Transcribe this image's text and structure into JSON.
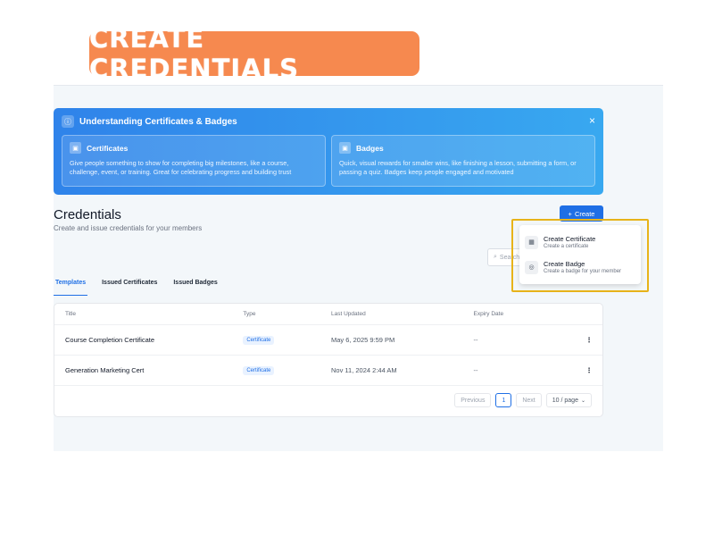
{
  "banner": {
    "text": "CREATE CREDENTIALS"
  },
  "info": {
    "title": "Understanding Certificates & Badges",
    "close": "×",
    "certificates": {
      "title": "Certificates",
      "desc": "Give people something to show for completing big milestones, like a course, challenge, event, or training. Great for celebrating progress and building trust"
    },
    "badges": {
      "title": "Badges",
      "desc": "Quick, visual rewards for smaller wins, like finishing a lesson, submitting a form, or passing a quiz. Badges keep people engaged and motivated"
    }
  },
  "page": {
    "title": "Credentials",
    "subtitle": "Create and issue credentials for your members",
    "create_label": "Create",
    "search_placeholder": "Search"
  },
  "dropdown": {
    "items": [
      {
        "title": "Create Certificate",
        "sub": "Create a certificate"
      },
      {
        "title": "Create Badge",
        "sub": "Create a badge for your member"
      }
    ]
  },
  "tabs": [
    "Templates",
    "Issued Certificates",
    "Issued Badges"
  ],
  "table": {
    "headers": [
      "Title",
      "Type",
      "Last Updated",
      "Expiry Date"
    ],
    "rows": [
      {
        "title": "Course Completion Certificate",
        "type": "Certificate",
        "updated": "May 6, 2025 9:59 PM",
        "expiry": "--"
      },
      {
        "title": "Generation Marketing Cert",
        "type": "Certificate",
        "updated": "Nov 11, 2024 2:44 AM",
        "expiry": "--"
      }
    ]
  },
  "pagination": {
    "previous": "Previous",
    "current": "1",
    "next": "Next",
    "page_size": "10 / page"
  },
  "colors": {
    "accent": "#1f6fe5",
    "banner": "#f6894f",
    "highlight": "#e7b319"
  }
}
